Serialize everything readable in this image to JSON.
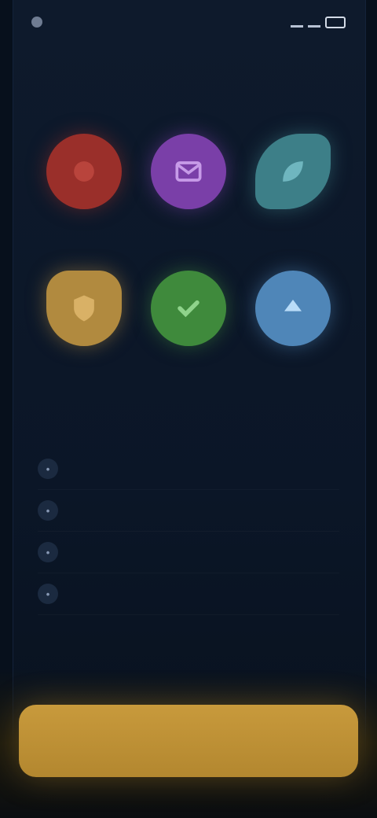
{
  "status_bar": {
    "time": "",
    "indicators": [
      "signal-icon",
      "wifi-icon",
      "battery-icon"
    ]
  },
  "header": {
    "title": "",
    "subtitle": ""
  },
  "grid": {
    "tiles": [
      {
        "icon": "circle-icon",
        "color": "#9a2f2a",
        "label": ""
      },
      {
        "icon": "mail-icon",
        "color": "#7a3fa8",
        "label": ""
      },
      {
        "icon": "leaf-icon",
        "color": "#3d7f88",
        "label": ""
      },
      {
        "icon": "shield-icon",
        "color": "#b18a3f",
        "label": ""
      },
      {
        "icon": "check-icon",
        "color": "#3f8a3c",
        "label": ""
      },
      {
        "icon": "arrow-up-icon",
        "color": "#4f86b8",
        "label": ""
      }
    ]
  },
  "steps": {
    "heading": "",
    "items": [
      {
        "icon": "dot-icon",
        "label": ""
      },
      {
        "icon": "dot-icon",
        "label": ""
      },
      {
        "icon": "dot-icon",
        "label": ""
      },
      {
        "icon": "dot-icon",
        "label": ""
      }
    ]
  },
  "cta": {
    "label": "",
    "color": "#c49536"
  }
}
